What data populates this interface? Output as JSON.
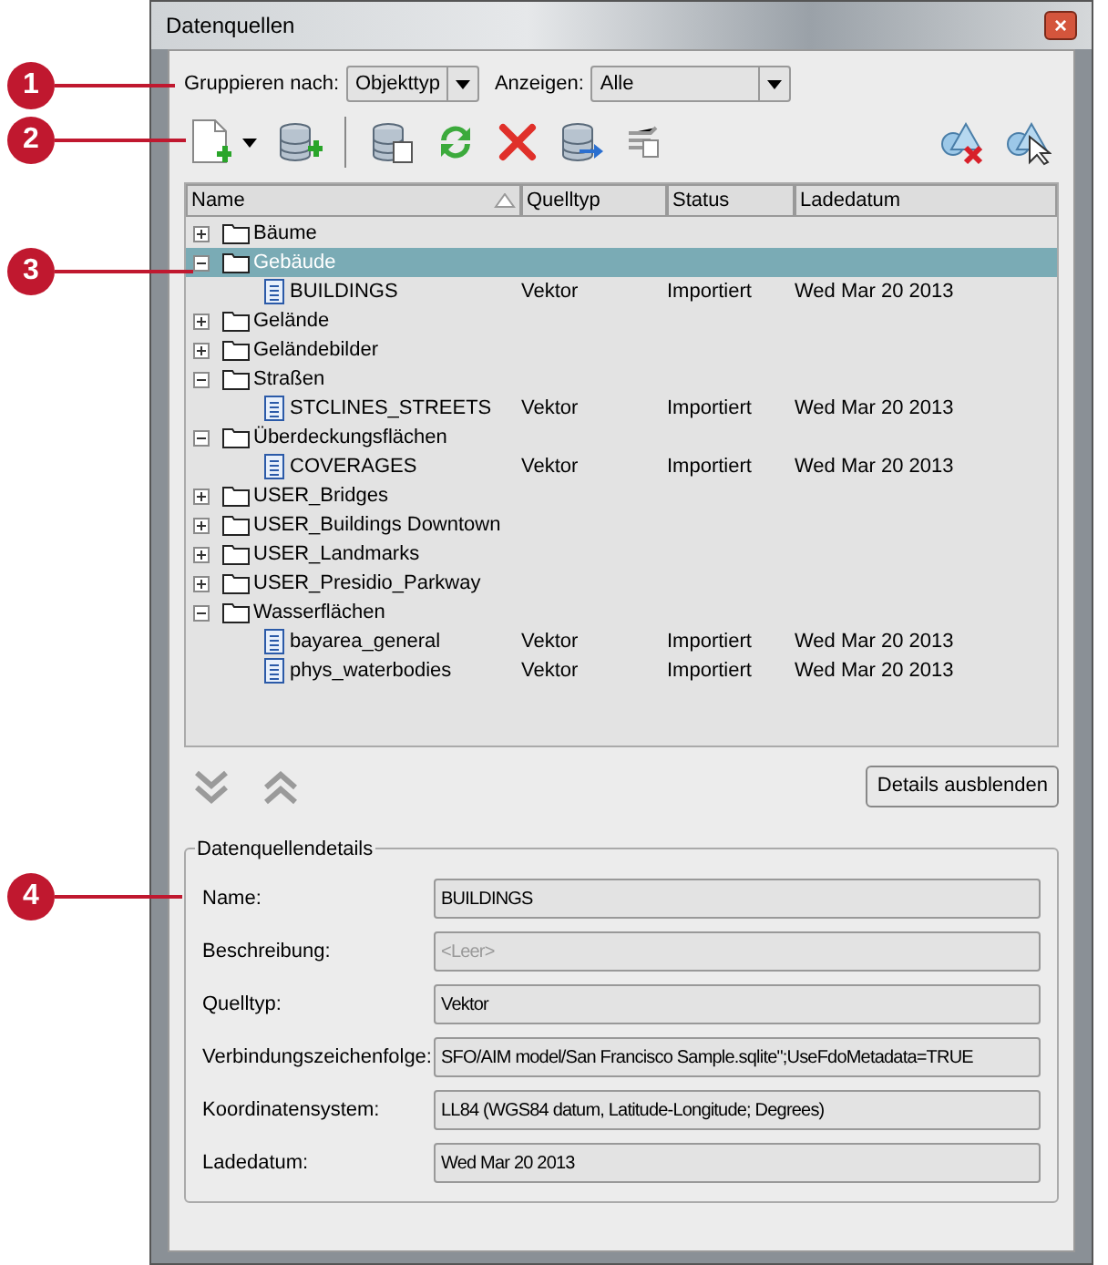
{
  "callouts": [
    "1",
    "2",
    "3",
    "4"
  ],
  "window": {
    "title": "Datenquellen",
    "close": "×"
  },
  "group_by": {
    "label": "Gruppieren nach:",
    "value": "Objekttyp"
  },
  "show": {
    "label": "Anzeigen:",
    "value": "Alle"
  },
  "tree": {
    "columns": [
      "Name",
      "Quelltyp",
      "Status",
      "Ladedatum"
    ],
    "items": [
      {
        "name": "Bäume",
        "expanded": false,
        "selected": false
      },
      {
        "name": "Gebäude",
        "expanded": true,
        "selected": true,
        "children": [
          {
            "name": "BUILDINGS",
            "quelltyp": "Vektor",
            "status": "Importiert",
            "ladedatum": "Wed Mar 20 2013"
          }
        ]
      },
      {
        "name": "Gelände",
        "expanded": false,
        "selected": false
      },
      {
        "name": "Geländebilder",
        "expanded": false,
        "selected": false
      },
      {
        "name": "Straßen",
        "expanded": true,
        "selected": false,
        "children": [
          {
            "name": "STCLINES_STREETS",
            "quelltyp": "Vektor",
            "status": "Importiert",
            "ladedatum": "Wed Mar 20 2013"
          }
        ]
      },
      {
        "name": "Überdeckungsflächen",
        "expanded": true,
        "selected": false,
        "children": [
          {
            "name": "COVERAGES",
            "quelltyp": "Vektor",
            "status": "Importiert",
            "ladedatum": "Wed Mar 20 2013"
          }
        ]
      },
      {
        "name": "USER_Bridges",
        "expanded": false,
        "selected": false
      },
      {
        "name": "USER_Buildings Downtown",
        "expanded": false,
        "selected": false
      },
      {
        "name": "USER_Landmarks",
        "expanded": false,
        "selected": false
      },
      {
        "name": "USER_Presidio_Parkway",
        "expanded": false,
        "selected": false
      },
      {
        "name": "Wasserflächen",
        "expanded": true,
        "selected": false,
        "children": [
          {
            "name": "bayarea_general",
            "quelltyp": "Vektor",
            "status": "Importiert",
            "ladedatum": "Wed Mar 20 2013"
          },
          {
            "name": "phys_waterbodies",
            "quelltyp": "Vektor",
            "status": "Importiert",
            "ladedatum": "Wed Mar 20 2013"
          }
        ]
      }
    ]
  },
  "details_button": "Details ausblenden",
  "details": {
    "title": "Datenquellendetails",
    "fields": [
      {
        "label": "Name:",
        "value": "BUILDINGS"
      },
      {
        "label": "Beschreibung:",
        "placeholder": "<Leer>"
      },
      {
        "label": "Quelltyp:",
        "value": "Vektor"
      },
      {
        "label": "Verbindungszeichenfolge:",
        "value": "SFO/AIM model/San Francisco Sample.sqlite\";UseFdoMetadata=TRUE"
      },
      {
        "label": "Koordinatensystem:",
        "value": "LL84 (WGS84 datum, Latitude-Longitude; Degrees)"
      },
      {
        "label": "Ladedatum:",
        "value": "Wed Mar 20 2013"
      }
    ]
  }
}
